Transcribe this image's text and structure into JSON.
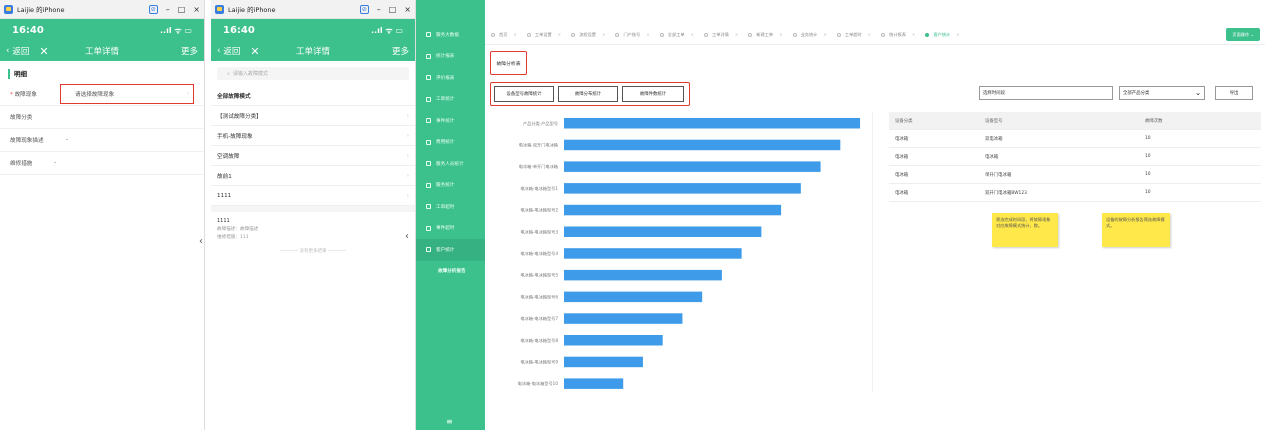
{
  "phone1": {
    "window_title": "Laijie 的iPhone",
    "time": "16:40",
    "status_icons": "..ıl ᯤ ▭",
    "back": "返回",
    "title": "工单详情",
    "more": "更多",
    "section": "明细",
    "fields": [
      {
        "label": "故障现象",
        "required": "*",
        "value": "请选择故障现象",
        "arrow": "›"
      },
      {
        "label": "故障分类",
        "required": "",
        "value": "",
        "arrow": ""
      },
      {
        "label": "故障现象描述",
        "required": "",
        "value": "-",
        "arrow": ""
      },
      {
        "label": "维修措施",
        "required": "",
        "value": "-",
        "arrow": ""
      }
    ]
  },
  "phone2": {
    "window_title": "Laijie 的iPhone",
    "time": "16:40",
    "status_icons": "..ıl ᯤ ▭",
    "back": "返回",
    "title": "工单详情",
    "more": "更多",
    "search_placeholder": "请输入故障模式",
    "all_label": "全部故障模式",
    "items": [
      "【测试故障分类】",
      "手机-故障现象",
      "空调故障",
      "故前1",
      "1111"
    ],
    "card_title": "1111",
    "card_sub1": "故障描述：故障描述",
    "card_sub2": "维修措施：111",
    "no_more": "没有更多结果"
  },
  "side_arrow": "‹",
  "sidebar": {
    "items": [
      {
        "label": "服务大数据",
        "active": false,
        "sub": false
      },
      {
        "label": "统计报表",
        "active": false,
        "sub": false
      },
      {
        "label": "评价报表",
        "active": false,
        "sub": false
      },
      {
        "label": "工单统计",
        "active": false,
        "sub": false
      },
      {
        "label": "事件统计",
        "active": false,
        "sub": false
      },
      {
        "label": "费用统计",
        "active": false,
        "sub": false
      },
      {
        "label": "服务人员统计",
        "active": false,
        "sub": false
      },
      {
        "label": "服务统计",
        "active": false,
        "sub": false
      },
      {
        "label": "工单超时",
        "active": false,
        "sub": false
      },
      {
        "label": "事件超时",
        "active": false,
        "sub": false
      },
      {
        "label": "客户统计",
        "active": true,
        "sub": false
      },
      {
        "label": "故障分析报告",
        "active": false,
        "sub": true
      }
    ],
    "menu_icon": "≡"
  },
  "tabs": [
    {
      "label": "首页",
      "active": false
    },
    {
      "label": "工单设置",
      "active": false
    },
    {
      "label": "流程设置",
      "active": false
    },
    {
      "label": "门户账号",
      "active": false
    },
    {
      "label": "全部工单",
      "active": false
    },
    {
      "label": "工单详情",
      "active": false
    },
    {
      "label": "新建工单",
      "active": false
    },
    {
      "label": "业务统计",
      "active": false
    },
    {
      "label": "工单超时",
      "active": false
    },
    {
      "label": "统计报表",
      "active": false
    },
    {
      "label": "客户统计",
      "active": true
    }
  ],
  "tab_close": "×",
  "quick_button": "页面操作 ⌄",
  "breadcrumb": "故障分析表",
  "stat_buttons": [
    "设备型号故障统计",
    "故障分布统计",
    "故障件数统计"
  ],
  "time_input": "选择时间段",
  "product_select": "全部产品分类",
  "export": "导出",
  "chart_data": {
    "type": "bar",
    "orientation": "horizontal",
    "categories": [
      "产品分类-产品型号",
      "电冰箱-双开门电冰箱",
      "电冰箱-单开门电冰箱",
      "电冰箱-电冰箱型号1",
      "电冰箱-电冰箱型号2",
      "电冰箱-电冰箱型号3",
      "电冰箱-电冰箱型号4",
      "电冰箱-电冰箱型号5",
      "电冰箱-电冰箱型号6",
      "电冰箱-电冰箱型号7",
      "电冰箱-电冰箱型号8",
      "电冰箱-电冰箱型号9",
      "电冰箱-电冰箱型号10"
    ],
    "values": [
      15,
      14,
      13,
      12,
      11,
      10,
      9,
      8,
      7,
      6,
      5,
      4,
      3
    ],
    "bar_color": "#3d9be9",
    "grid": false,
    "xlabel": "",
    "ylabel": "",
    "title": ""
  },
  "table": {
    "headers": [
      "设备分类",
      "设备型号",
      "故障次数"
    ],
    "rows": [
      [
        "电冰箱",
        "双电冰箱",
        "10"
      ],
      [
        "电冰箱",
        "电冰箱",
        "10"
      ],
      [
        "电冰箱",
        "单开门电冰箱",
        "10"
      ],
      [
        "电冰箱",
        "双开门电冰箱BW123",
        "10"
      ]
    ]
  },
  "notes": [
    "筛选完成时间段，将故障现象对应故障模式统计，数。",
    "设备的故障分析报告筛选故障模式。"
  ],
  "colors": {
    "accent": "#3cc08c",
    "bar": "#3d9be9",
    "highlight": "#e23b2e",
    "note": "#ffe84a"
  }
}
